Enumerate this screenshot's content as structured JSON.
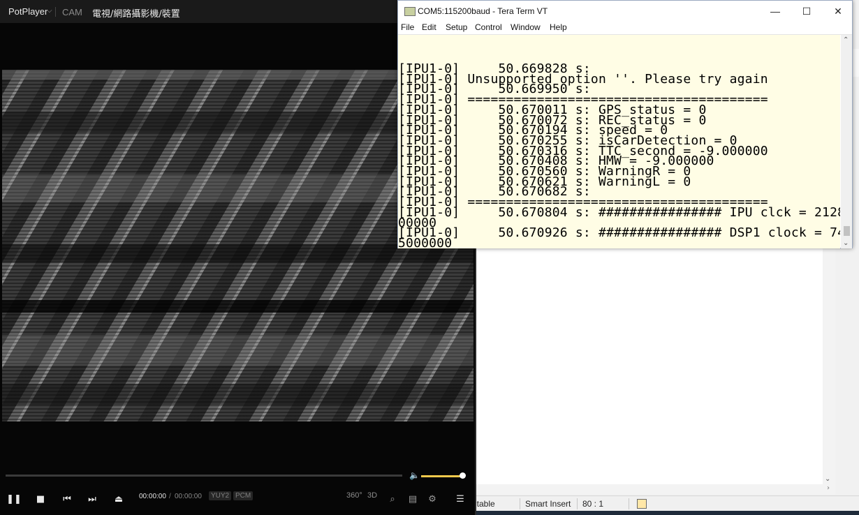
{
  "potplayer": {
    "app_name": "PotPlayer",
    "source_tab": "CAM",
    "device_title": "電視/網路攝影機/裝置",
    "time_current": "00:00:00",
    "time_separator": "/",
    "time_total": "00:00:00",
    "video_format": "YUY2",
    "audio_format": "PCM",
    "btn_360": "360°",
    "btn_3d": "3D",
    "volume_level_percent": 100,
    "seek_progress_percent": 0
  },
  "editor": {
    "status_mode": "itable",
    "status_insert": "Smart Insert",
    "status_position": "80 : 1"
  },
  "teraterm": {
    "title": "COM5:115200baud - Tera Term VT",
    "menu": [
      "File",
      "Edit",
      "Setup",
      "Control",
      "Window",
      "Help"
    ],
    "lines": [
      "[IPU1-0]     50.669828 s:",
      "[IPU1-0] Unsupported option ''. Please try again",
      "[IPU1-0]     50.669950 s:",
      "[IPU1-0] =======================================",
      "[IPU1-0]     50.670011 s: GPS_status = 0",
      "[IPU1-0]     50.670072 s: REC_status = 0",
      "[IPU1-0]     50.670194 s: speed = 0",
      "[IPU1-0]     50.670255 s: isCarDetection = 0",
      "[IPU1-0]     50.670316 s: TTC_second = -9.000000",
      "[IPU1-0]     50.670408 s: HMW = -9.000000",
      "[IPU1-0]     50.670560 s: WarningR = 0",
      "[IPU1-0]     50.670621 s: WarningL = 0",
      "[IPU1-0]     50.670682 s:",
      "[IPU1-0] =======================================",
      "[IPU1-0]     50.670804 s: ################ IPU clck = 2128",
      "00000",
      "[IPU1-0]     50.670926 s: ################ DSP1 clock = 74",
      "5000000"
    ]
  },
  "colors": {
    "terminal_bg": "#fffde5",
    "potplayer_bg": "#060606",
    "volume_accent": "#f2c94c"
  }
}
